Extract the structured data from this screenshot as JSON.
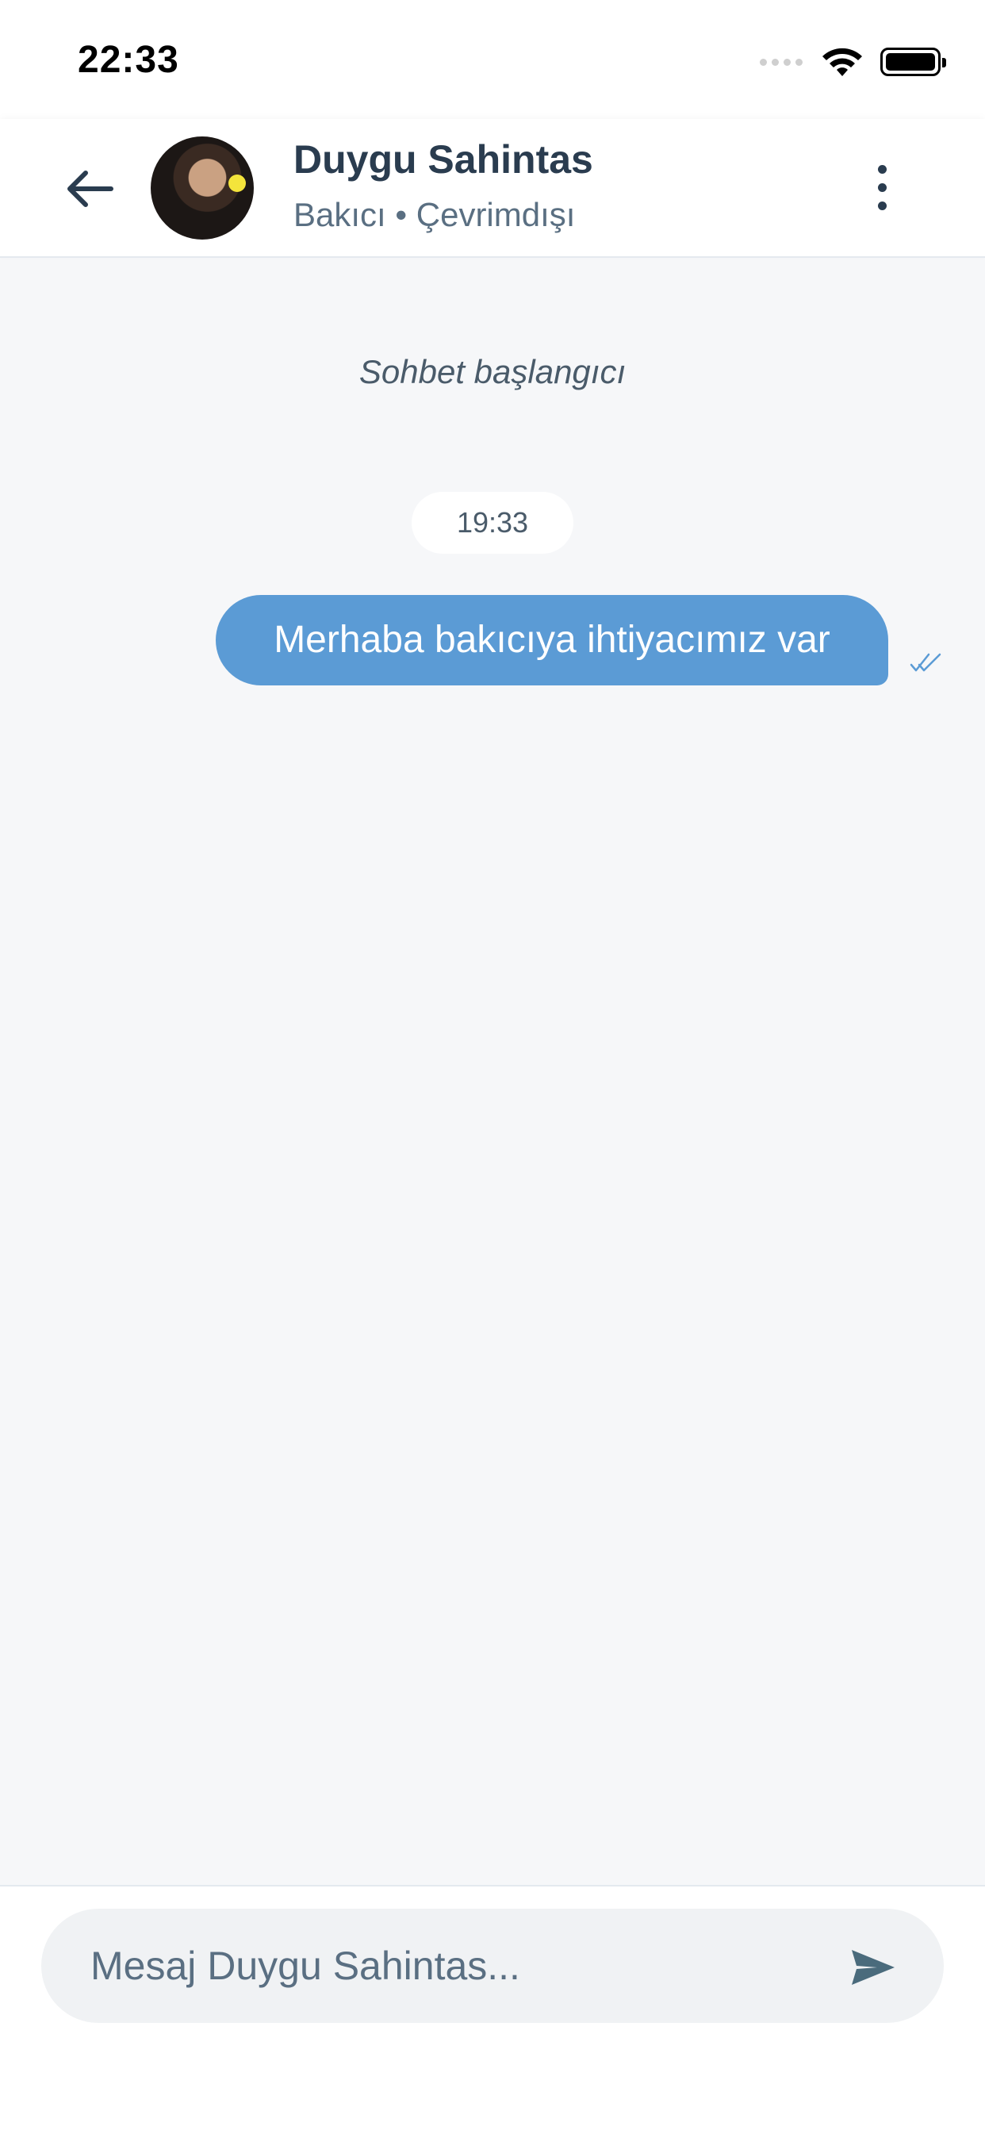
{
  "status_bar": {
    "time": "22:33"
  },
  "header": {
    "contact_name": "Duygu Sahintas",
    "contact_status": "Bakıcı • Çevrimdışı"
  },
  "chat": {
    "start_label": "Sohbet başlangıcı",
    "timestamp": "19:33",
    "messages": [
      {
        "text": "Merhaba bakıcıya ihtiyacımız var",
        "direction": "outgoing",
        "status": "read"
      }
    ]
  },
  "composer": {
    "placeholder": "Mesaj Duygu Sahintas..."
  },
  "colors": {
    "accent": "#5b9bd5",
    "header_text": "#2a3c4f",
    "secondary_text": "#5a6f82",
    "background": "#f6f7f9"
  },
  "icons": {
    "back": "arrow-left-icon",
    "more": "more-vertical-icon",
    "send": "send-icon",
    "read": "double-check-icon"
  }
}
